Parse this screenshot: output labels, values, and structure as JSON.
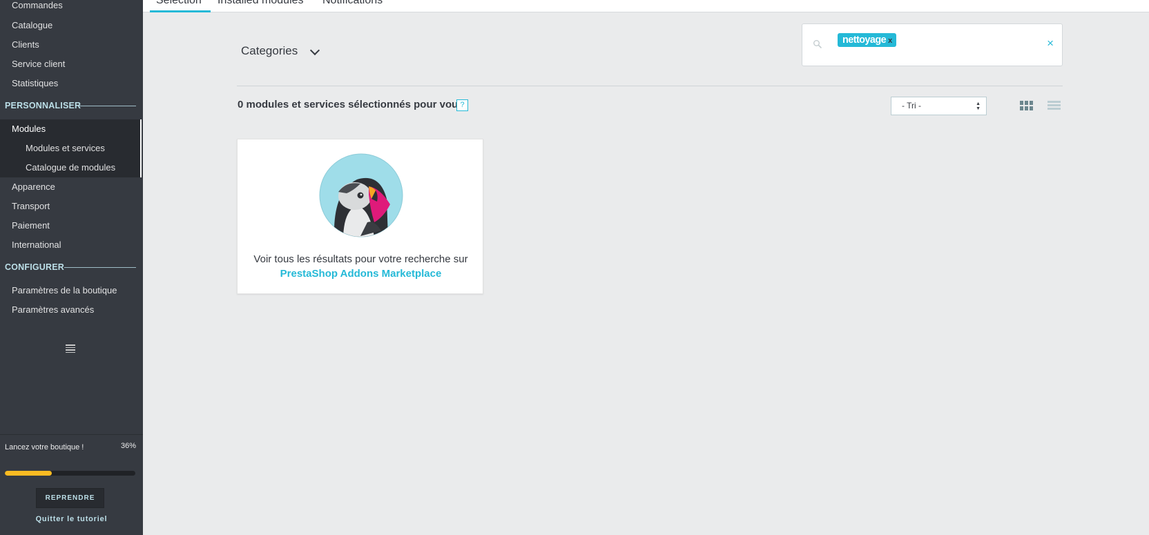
{
  "sidebar": {
    "top_items": [
      "Commandes",
      "Catalogue",
      "Clients",
      "Service client",
      "Statistiques"
    ],
    "section_personnaliser": "PERSONNALISER",
    "active_item": "Modules",
    "sub_items": [
      "Modules et services",
      "Catalogue de modules"
    ],
    "more_items": [
      "Apparence",
      "Transport",
      "Paiement",
      "International"
    ],
    "section_configurer": "CONFIGURER",
    "config_items": [
      "Paramètres de la boutique",
      "Paramètres avancés"
    ]
  },
  "tutorial": {
    "label": "Lancez votre boutique !",
    "percent_text": "36%",
    "progress": 0.36,
    "resume_label": "REPRENDRE",
    "quit_label": "Quitter le tutoriel"
  },
  "tabs": [
    "Sélection",
    "Installed modules",
    "Notifications"
  ],
  "main": {
    "categories_label": "Categories",
    "search_tag": "nettoyage",
    "search_tag_remove": "x",
    "clear_label": "×",
    "results_title": "0 modules et services sélectionnés pour vous",
    "help_label": "?",
    "sort_value": "- Tri -",
    "card_text": "Voir tous les résultats pour votre recherche sur",
    "card_link": "PrestaShop Addons Marketplace"
  },
  "colors": {
    "accent": "#25b9d7",
    "sidebar_bg": "#363a41",
    "progress": "#fbbb22"
  }
}
